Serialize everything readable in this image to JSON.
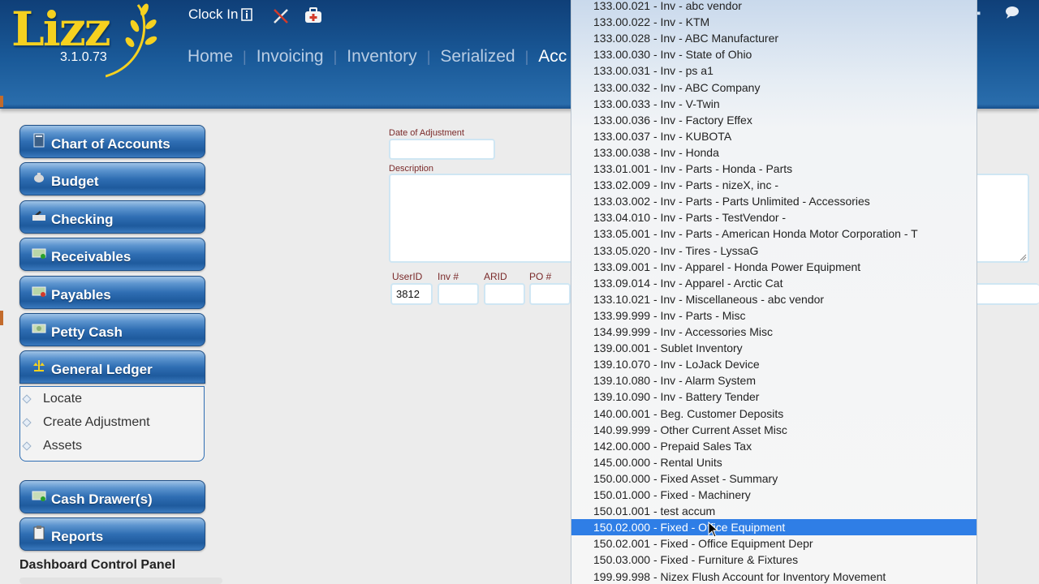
{
  "app": {
    "logo_text": "Lizz",
    "version": "3.1.0.73",
    "clock_in_label": "Clock In",
    "nav": [
      "Home",
      "Invoicing",
      "Inventory",
      "Serialized",
      "Acc"
    ],
    "active_nav": "Acc",
    "colors": {
      "header": "#1a5a99",
      "logo": "#f6d11f",
      "selected": "#2f7ee6"
    }
  },
  "sidebar": {
    "buttons": [
      {
        "label": "Chart of Accounts",
        "icon": "book-icon"
      },
      {
        "label": "Budget",
        "icon": "piggy-bank-icon"
      },
      {
        "label": "Checking",
        "icon": "checkbook-icon"
      },
      {
        "label": "Receivables",
        "icon": "money-in-icon"
      },
      {
        "label": "Payables",
        "icon": "money-out-icon"
      },
      {
        "label": "Petty Cash",
        "icon": "cash-icon"
      },
      {
        "label": "General Ledger",
        "icon": "scale-icon"
      },
      {
        "label": "Cash Drawer(s)",
        "icon": "cash-drawer-icon"
      },
      {
        "label": "Reports",
        "icon": "clipboard-icon"
      }
    ],
    "submenu": [
      "Locate",
      "Create Adjustment",
      "Assets"
    ],
    "dashboard_title": "Dashboard Control Panel"
  },
  "form": {
    "date_label": "Date of Adjustment",
    "date_value": "",
    "description_label": "Description",
    "description_value": "",
    "userid_label": "UserID",
    "userid_value": "3812",
    "inv_label": "Inv #",
    "inv_value": "",
    "arid_label": "ARID",
    "arid_value": "",
    "po_label": "PO #",
    "po_value": ""
  },
  "dropdown": {
    "selected_index": 32,
    "items": [
      "133.00.021 - Inv - abc vendor",
      "133.00.022 - Inv - KTM",
      "133.00.028 - Inv - ABC Manufacturer",
      "133.00.030 - Inv - State of Ohio",
      "133.00.031 - Inv - ps a1",
      "133.00.032 - Inv - ABC Company",
      "133.00.033 - Inv - V-Twin",
      "133.00.036 - Inv - Factory Effex",
      "133.00.037 - Inv - KUBOTA",
      "133.00.038 - Inv - Honda",
      "133.01.001 - Inv - Parts - Honda - Parts",
      "133.02.009 - Inv - Parts - nizeX, inc -",
      "133.03.002 - Inv - Parts - Parts Unlimited - Accessories",
      "133.04.010 - Inv - Parts - TestVendor -",
      "133.05.001 - Inv - Parts - American Honda Motor Corporation - T",
      "133.05.020 - Inv - Tires - LyssaG",
      "133.09.001 - Inv - Apparel - Honda Power Equipment",
      "133.09.014 - Inv - Apparel - Arctic Cat",
      "133.10.021 - Inv - Miscellaneous - abc vendor",
      "133.99.999 - Inv - Parts - Misc",
      "134.99.999 - Inv - Accessories Misc",
      "139.00.001 - Sublet Inventory",
      "139.10.070 - Inv - LoJack Device",
      "139.10.080 - Inv - Alarm System",
      "139.10.090 - Inv - Battery Tender",
      "140.00.001 - Beg. Customer Deposits",
      "140.99.999 - Other Current Asset Misc",
      "142.00.000 - Prepaid Sales Tax",
      "145.00.000 - Rental Units",
      "150.00.000 - Fixed Asset - Summary",
      "150.01.000 - Fixed - Machinery",
      "150.01.001 - test accum",
      "150.02.000 - Fixed - Office Equipment",
      "150.02.001 - Fixed - Office Equipment Depr",
      "150.03.000 - Fixed - Furniture & Fixtures",
      "199.99.998 - Nizex Flush Account for Inventory Movement"
    ]
  }
}
